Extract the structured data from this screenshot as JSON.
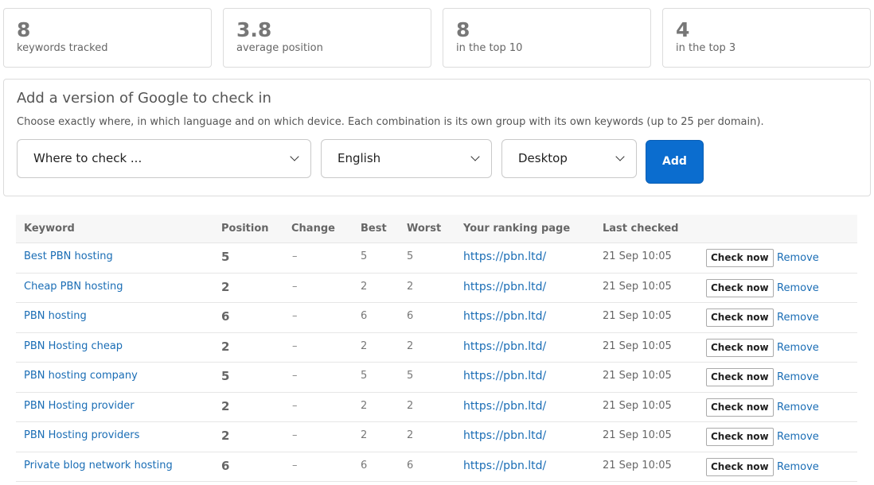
{
  "stats": [
    {
      "value": "8",
      "label": "keywords tracked"
    },
    {
      "value": "3.8",
      "label": "average position"
    },
    {
      "value": "8",
      "label": "in the top 10"
    },
    {
      "value": "4",
      "label": "in the top 3"
    }
  ],
  "add_panel": {
    "title": "Add a version of Google to check in",
    "description": "Choose exactly where, in which language and on which device. Each combination is its own group with its own keywords (up to 25 per domain).",
    "where_value": "Where to check ...",
    "language_value": "English",
    "device_value": "Desktop",
    "add_label": "Add"
  },
  "table": {
    "headers": [
      "Keyword",
      "Position",
      "Change",
      "Best",
      "Worst",
      "Your ranking page",
      "Last checked"
    ],
    "check_label": "Check now",
    "remove_label": "Remove",
    "rows": [
      {
        "keyword": "Best PBN hosting",
        "position": "5",
        "change": "–",
        "best": "5",
        "worst": "5",
        "page": "https://pbn.ltd/",
        "checked": "21 Sep 10:05"
      },
      {
        "keyword": "Cheap PBN hosting",
        "position": "2",
        "change": "–",
        "best": "2",
        "worst": "2",
        "page": "https://pbn.ltd/",
        "checked": "21 Sep 10:05"
      },
      {
        "keyword": "PBN hosting",
        "position": "6",
        "change": "–",
        "best": "6",
        "worst": "6",
        "page": "https://pbn.ltd/",
        "checked": "21 Sep 10:05"
      },
      {
        "keyword": "PBN Hosting cheap",
        "position": "2",
        "change": "–",
        "best": "2",
        "worst": "2",
        "page": "https://pbn.ltd/",
        "checked": "21 Sep 10:05"
      },
      {
        "keyword": "PBN hosting company",
        "position": "5",
        "change": "–",
        "best": "5",
        "worst": "5",
        "page": "https://pbn.ltd/",
        "checked": "21 Sep 10:05"
      },
      {
        "keyword": "PBN Hosting provider",
        "position": "2",
        "change": "–",
        "best": "2",
        "worst": "2",
        "page": "https://pbn.ltd/",
        "checked": "21 Sep 10:05"
      },
      {
        "keyword": "PBN Hosting providers",
        "position": "2",
        "change": "–",
        "best": "2",
        "worst": "2",
        "page": "https://pbn.ltd/",
        "checked": "21 Sep 10:05"
      },
      {
        "keyword": "Private blog network hosting",
        "position": "6",
        "change": "–",
        "best": "6",
        "worst": "6",
        "page": "https://pbn.ltd/",
        "checked": "21 Sep 10:05"
      }
    ]
  }
}
